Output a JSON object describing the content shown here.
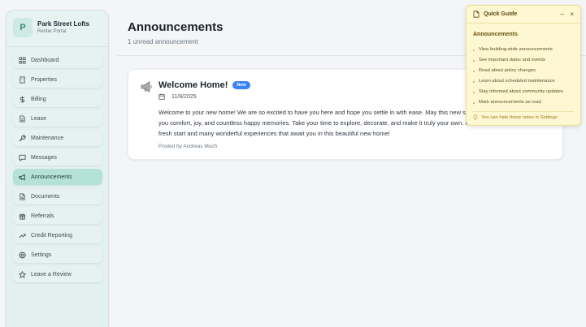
{
  "brand": {
    "logo_letter": "P",
    "name": "Park Street Lofts",
    "subtitle": "Renter Portal"
  },
  "sidebar": {
    "items": [
      {
        "label": "Dashboard",
        "icon": "dashboard-icon"
      },
      {
        "label": "Properties",
        "icon": "building-icon"
      },
      {
        "label": "Billing",
        "icon": "dollar-icon"
      },
      {
        "label": "Lease",
        "icon": "document-icon"
      },
      {
        "label": "Maintenance",
        "icon": "wrench-icon"
      },
      {
        "label": "Messages",
        "icon": "chat-icon"
      },
      {
        "label": "Announcements",
        "icon": "megaphone-icon",
        "active": true
      },
      {
        "label": "Documents",
        "icon": "file-icon"
      },
      {
        "label": "Referrals",
        "icon": "gift-icon"
      },
      {
        "label": "Credit Reporting",
        "icon": "trend-icon"
      },
      {
        "label": "Settings",
        "icon": "gear-icon"
      },
      {
        "label": "Leave a Review",
        "icon": "star-icon"
      }
    ]
  },
  "header": {
    "title": "Announcements",
    "subtitle": "1 unread announcement"
  },
  "announcement": {
    "title": "Welcome Home!",
    "badge": "New",
    "date": "11/8/2025",
    "body": "Welcome to your new home! We are so excited to have you here and hope you settle in with ease. May this new space bring you comfort, joy, and countless happy memories. Take your time to explore, decorate, and make it truly your own. Here's to a fresh start and many wonderful experiences that await you in this beautiful new home!",
    "posted_by": "Posted by Andreas Much"
  },
  "quick_guide": {
    "title": "Quick Guide",
    "minimize": "–",
    "close": "×",
    "section_title": "Announcements",
    "items": [
      "View building-wide announcements",
      "See important dates and events",
      "Read about policy changes",
      "Learn about scheduled maintenance",
      "Stay informed about community updates",
      "Mark announcements as read"
    ],
    "tip": "You can hide these notes in Settings"
  },
  "colors": {
    "accent": "#b4e2d6",
    "badge": "#3b82f6",
    "guide_bg": "#fdf7d2"
  }
}
